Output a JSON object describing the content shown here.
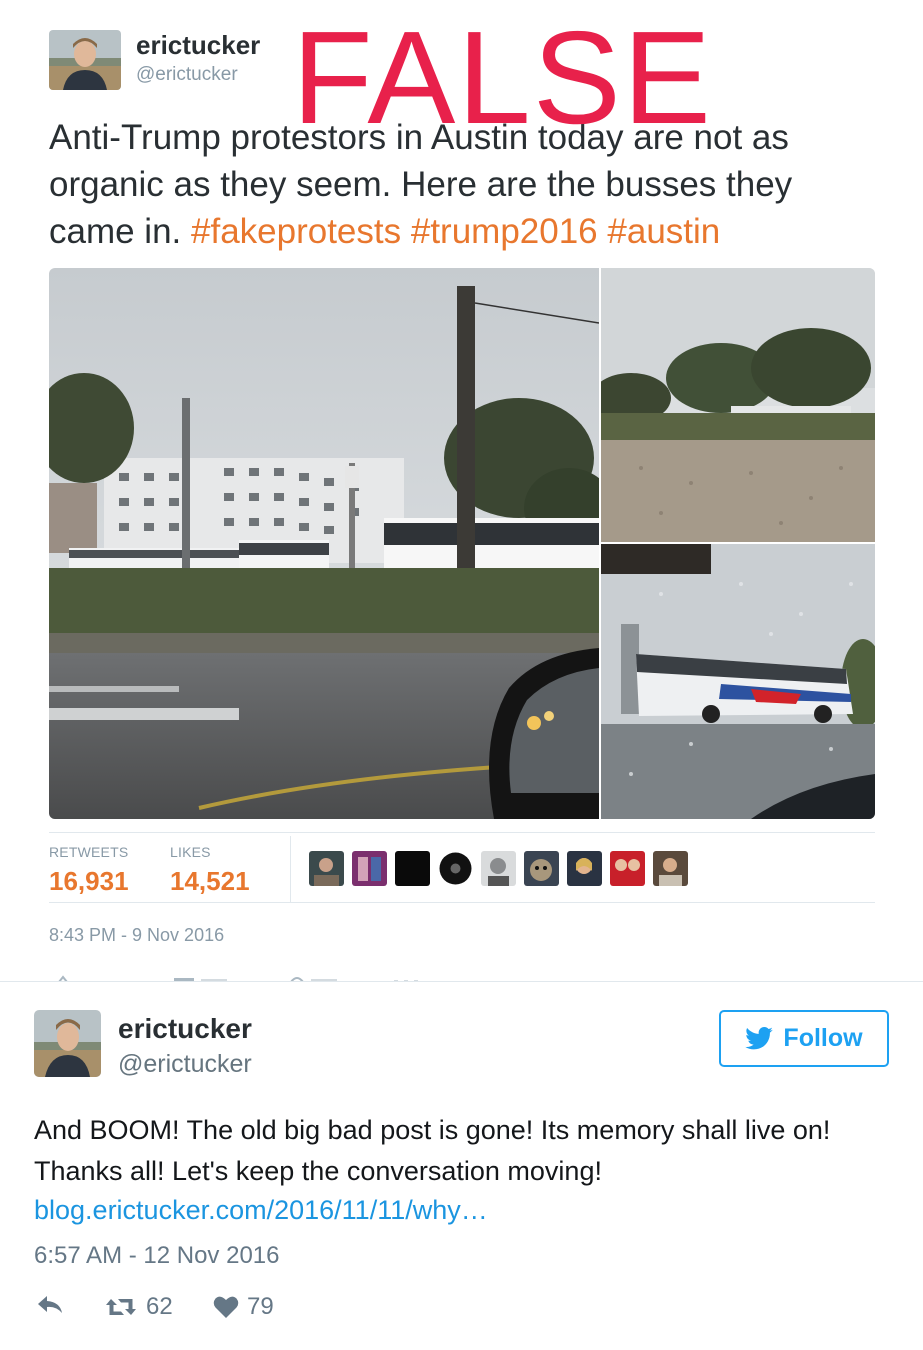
{
  "stamp": "FALSE",
  "tweet1": {
    "name": "erictucker",
    "handle": "@erictucker",
    "text_plain": "Anti-Trump protestors in Austin today are not as organic as they seem.  Here are the busses they came in. ",
    "hashtags": [
      "#fakeprotests",
      "#trump2016",
      "#austin"
    ],
    "stats": {
      "retweets_label": "RETWEETS",
      "retweets": "16,931",
      "likes_label": "LIKES",
      "likes": "14,521"
    },
    "timestamp": "8:43 PM - 9 Nov 2016",
    "hashtag_color": "#e8772e"
  },
  "tweet2": {
    "name": "erictucker",
    "handle": "@erictucker",
    "follow_label": "Follow",
    "text": "And BOOM! The old big bad post is gone! Its memory shall live on! Thanks all! Let's keep the conversation moving!",
    "link": "blog.erictucker.com/2016/11/11/why…",
    "timestamp": "6:57 AM - 12 Nov 2016",
    "retweets": "62",
    "likes": "79",
    "link_color": "#1b95e0",
    "follow_color": "#1da1f2"
  }
}
